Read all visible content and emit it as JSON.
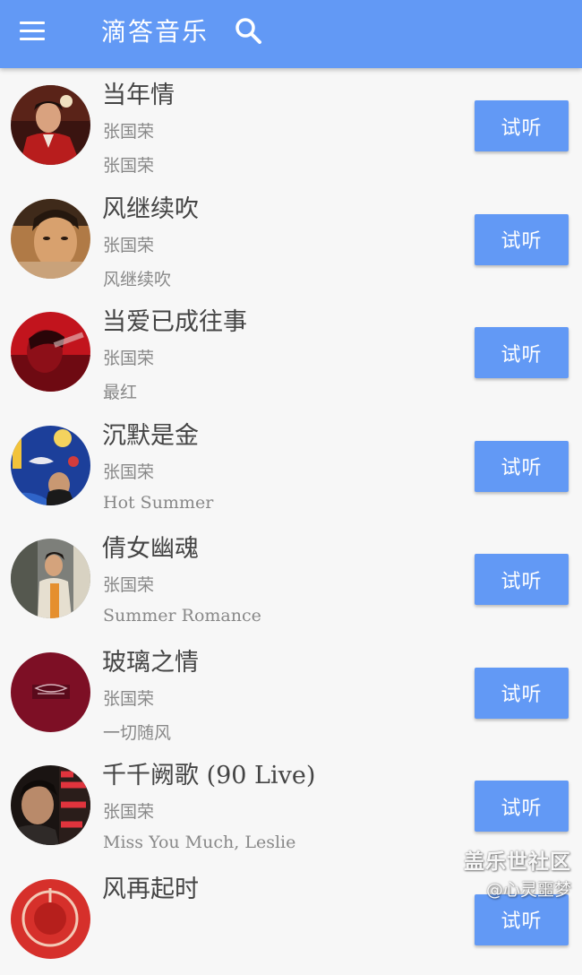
{
  "header": {
    "title": "滴答音乐",
    "menu_icon": "menu-icon",
    "search_icon": "search-icon",
    "color": "#6299f5"
  },
  "songs": [
    {
      "title": "当年情",
      "artist": "张国荣",
      "album": "张国荣",
      "button": "试听"
    },
    {
      "title": "风继续吹",
      "artist": "张国荣",
      "album": "风继续吹",
      "button": "试听"
    },
    {
      "title": "当爱已成往事",
      "artist": "张国荣",
      "album": "最红",
      "button": "试听"
    },
    {
      "title": "沉默是金",
      "artist": "张国荣",
      "album": "Hot Summer",
      "button": "试听"
    },
    {
      "title": "倩女幽魂",
      "artist": "张国荣",
      "album": "Summer Romance",
      "button": "试听"
    },
    {
      "title": "玻璃之情",
      "artist": "张国荣",
      "album": "一切随风",
      "button": "试听"
    },
    {
      "title": "千千阙歌 (90 Live)",
      "artist": "张国荣",
      "album": "Miss You Much, Leslie",
      "button": "试听"
    },
    {
      "title": "风再起时",
      "artist": "",
      "album": "",
      "button": "试听"
    }
  ],
  "watermark": {
    "line1": "盖乐世社区",
    "line2": "@心灵噩梦"
  }
}
